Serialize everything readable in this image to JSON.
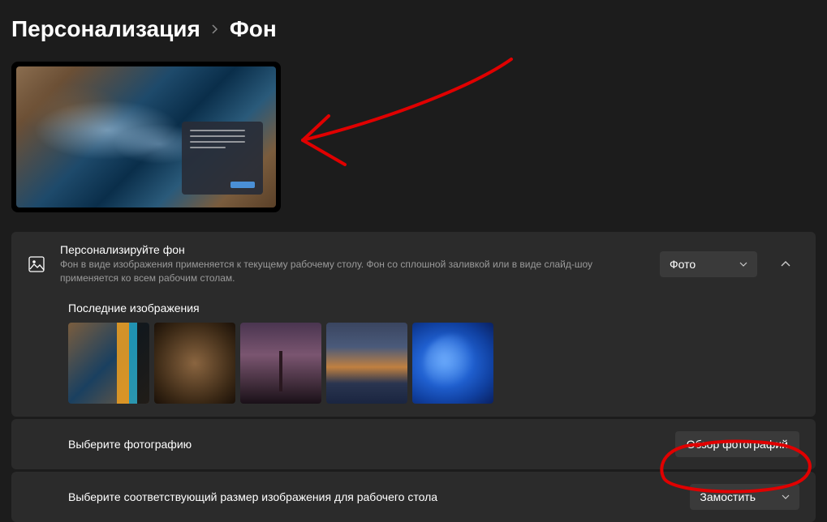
{
  "breadcrumb": {
    "parent": "Персонализация",
    "current": "Фон"
  },
  "personalize_card": {
    "title": "Персонализируйте фон",
    "desc": "Фон в виде изображения применяется к текущему рабочему столу. Фон со сплошной заливкой или в виде слайд-шоу применяется ко всем рабочим столам.",
    "dropdown_value": "Фото"
  },
  "recent": {
    "title": "Последние изображения"
  },
  "choose_photo": {
    "label": "Выберите фотографию",
    "button": "Обзор фотографий"
  },
  "fit": {
    "label": "Выберите соответствующий размер изображения для рабочего стола",
    "dropdown_value": "Замостить"
  }
}
